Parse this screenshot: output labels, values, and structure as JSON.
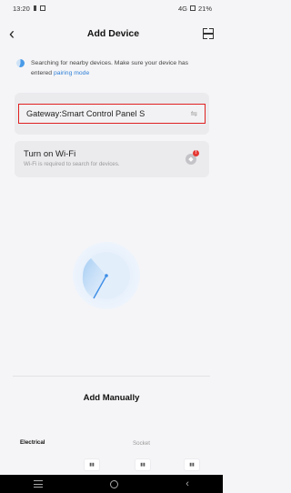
{
  "status_bar": {
    "time": "13:20",
    "network": "4G",
    "battery": "21%"
  },
  "header": {
    "title": "Add Device",
    "back_icon": "chevron-left-icon",
    "scan_icon": "scan-icon"
  },
  "searching": {
    "text": "Searching for nearby devices. Make sure your device has entered ",
    "link": "pairing mode"
  },
  "gateway": {
    "label": "Gateway:Smart Control Panel S",
    "icon": "swap-icon"
  },
  "wifi": {
    "title": "Turn on Wi-Fi",
    "subtitle": "Wi-Fi is required to search for devices.",
    "badge": "!"
  },
  "add_manually": {
    "title": "Add Manually",
    "categories": [
      "Electrical",
      "Socket"
    ]
  },
  "colors": {
    "accent": "#2f7fd8",
    "highlight_border": "#e02020",
    "alert": "#e53935"
  }
}
